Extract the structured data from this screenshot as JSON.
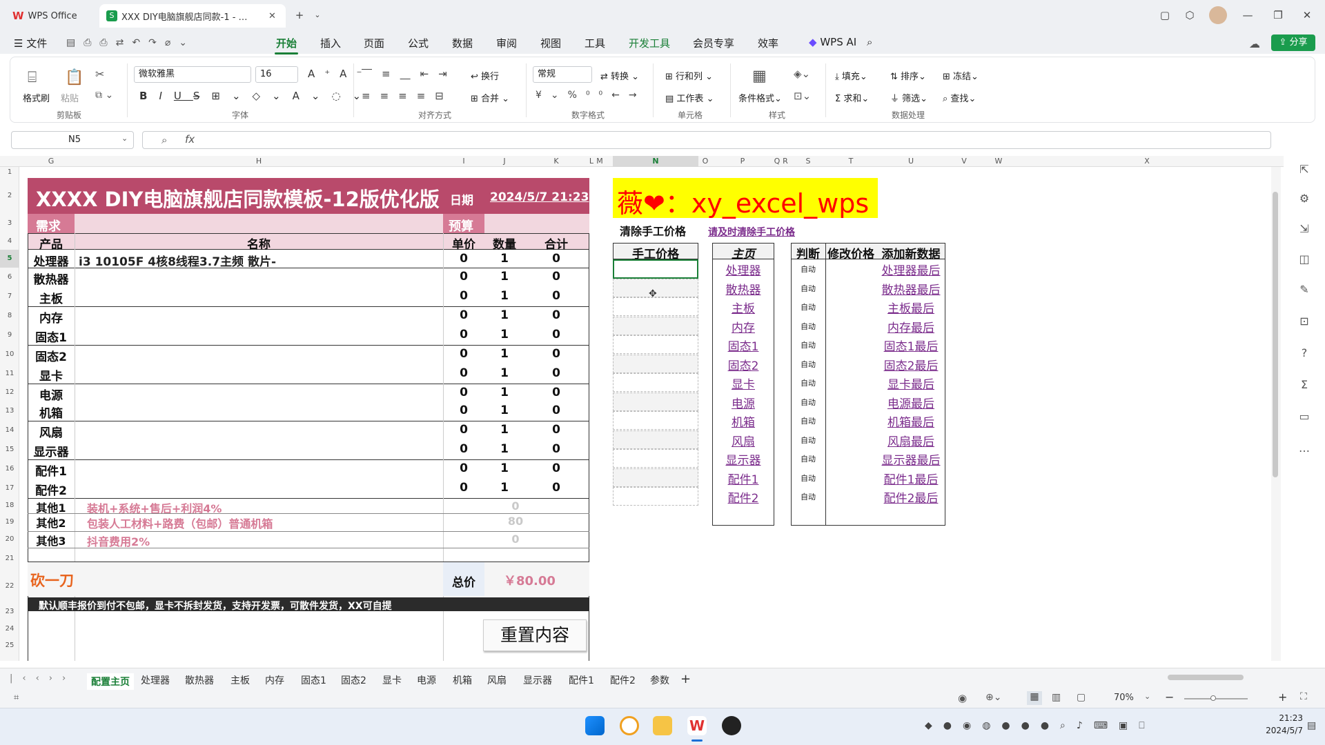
{
  "titlebar": {
    "app_tab": "WPS Office",
    "doc_tab": "XXX DIY电脑旗舰店同款-1 - …",
    "new_tab": "+"
  },
  "menu": {
    "file": "文件",
    "items": [
      "开始",
      "插入",
      "页面",
      "公式",
      "数据",
      "审阅",
      "视图",
      "工具",
      "开发工具",
      "会员专享",
      "效率"
    ],
    "active": "开始",
    "wps_ai": "WPS AI",
    "share": "分享"
  },
  "ribbon": {
    "format_painter": "格式刷",
    "paste": "粘贴",
    "font_name": "微软雅黑",
    "font_size": "16",
    "wrap": "换行",
    "merge": "合并",
    "number_format": "常规",
    "convert": "转换",
    "row_col": "行和列",
    "worksheet": "工作表",
    "cond_format": "条件格式",
    "fill": "填充",
    "sort": "排序",
    "freeze": "冻结",
    "sum": "求和",
    "filter": "筛选",
    "find": "查找",
    "groups": [
      "剪贴板",
      "字体",
      "对齐方式",
      "数字格式",
      "单元格",
      "样式",
      "数据处理"
    ]
  },
  "formula": {
    "name_box": "N5",
    "fx": "fx",
    "value": ""
  },
  "columns": [
    "G",
    "H",
    "I",
    "J",
    "K",
    "L",
    "M",
    "N",
    "O",
    "P",
    "Q",
    "R",
    "S",
    "T",
    "U",
    "V",
    "W",
    "X"
  ],
  "sheet": {
    "title": "XXXX DIY电脑旗舰店同款模板-12版优化版",
    "date_label": "日期",
    "date_value": "2024/5/7 21:23",
    "demand": "需求",
    "budget": "预算",
    "headers": {
      "product": "产品",
      "name": "名称",
      "unit_price": "单价",
      "qty": "数量",
      "total": "合计"
    },
    "rows": [
      {
        "product": "处理器",
        "name": "i3 10105F 4核8线程3.7主频 散片-",
        "price": "0",
        "qty": "1",
        "total": "0"
      },
      {
        "product": "散热器",
        "name": "",
        "price": "0",
        "qty": "1",
        "total": "0"
      },
      {
        "product": "主板",
        "name": "",
        "price": "0",
        "qty": "1",
        "total": "0"
      },
      {
        "product": "内存",
        "name": "",
        "price": "0",
        "qty": "1",
        "total": "0"
      },
      {
        "product": "固态1",
        "name": "",
        "price": "0",
        "qty": "1",
        "total": "0"
      },
      {
        "product": "固态2",
        "name": "",
        "price": "0",
        "qty": "1",
        "total": "0"
      },
      {
        "product": "显卡",
        "name": "",
        "price": "0",
        "qty": "1",
        "total": "0"
      },
      {
        "product": "电源",
        "name": "",
        "price": "0",
        "qty": "1",
        "total": "0"
      },
      {
        "product": "机箱",
        "name": "",
        "price": "0",
        "qty": "1",
        "total": "0"
      },
      {
        "product": "风扇",
        "name": "",
        "price": "0",
        "qty": "1",
        "total": "0"
      },
      {
        "product": "显示器",
        "name": "",
        "price": "0",
        "qty": "1",
        "total": "0"
      },
      {
        "product": "配件1",
        "name": "",
        "price": "0",
        "qty": "1",
        "total": "0"
      },
      {
        "product": "配件2",
        "name": "",
        "price": "0",
        "qty": "1",
        "total": "0"
      }
    ],
    "others": [
      {
        "label": "其他1",
        "desc": "装机+系统+售后+利润4%",
        "value": "0"
      },
      {
        "label": "其他2",
        "desc": "包装人工材料+路费（包邮）普通机箱",
        "value": "80"
      },
      {
        "label": "其他3",
        "desc": "抖音费用2%",
        "value": "0"
      }
    ],
    "bargain": "砍一刀",
    "total_label": "总价",
    "total_value": "￥80.00",
    "footer_note": "默认顺丰报价到付不包邮，显卡不拆封发货，支持开发票，可散件发货，XX可自提",
    "reset_button": "重置内容",
    "wechat": "薇❤：xy_excel_wps",
    "clear_manual": "清除手工价格",
    "clear_manual_link": "请及时清除手工价格",
    "manual_price_header": "手工价格",
    "home_header": "主页",
    "judge_header": "判断",
    "edit_price_header": "修改价格",
    "add_data_header": "添加新数据",
    "home_links": [
      "处理器",
      "散热器",
      "主板",
      "内存",
      "固态1",
      "固态2",
      "显卡",
      "电源",
      "机箱",
      "风扇",
      "显示器",
      "配件1",
      "配件2"
    ],
    "auto_label": "自动",
    "last_links": [
      "处理器最后",
      "散热器最后",
      "主板最后",
      "内存最后",
      "固态1最后",
      "固态2最后",
      "显卡最后",
      "电源最后",
      "机箱最后",
      "风扇最后",
      "显示器最后",
      "配件1最后",
      "配件2最后"
    ]
  },
  "sheet_tabs": [
    "配置主页",
    "处理器",
    "散热器",
    "主板",
    "内存",
    "固态1",
    "固态2",
    "显卡",
    "电源",
    "机箱",
    "风扇",
    "显示器",
    "配件1",
    "配件2",
    "参数"
  ],
  "active_sheet": "配置主页",
  "status": {
    "zoom": "70%"
  },
  "taskbar": {
    "time": "21:23",
    "date": "2024/5/7"
  },
  "colors": {
    "title_bg": "#b94a6b",
    "header_bg": "#f2d7df",
    "accent_green": "#1a7f37",
    "wechat_bg": "#ffff00",
    "wechat_text": "#ff0000",
    "bargain": "#e8641e",
    "link": "#7b2c8c"
  }
}
